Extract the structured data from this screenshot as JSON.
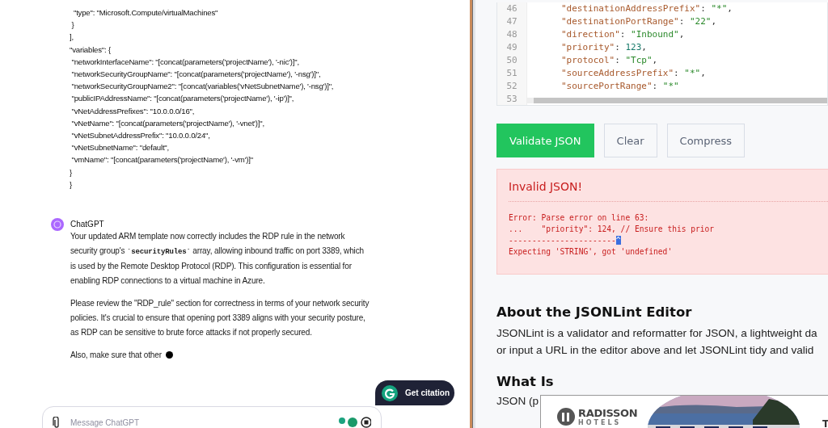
{
  "chat": {
    "code_lines": [
      "  \"type\": \"Microsoft.Compute/virtualMachines\"",
      " }",
      "],",
      "\"variables\": {",
      " \"networkInterfaceName\": \"[concat(parameters('projectName'), '-nic')]\",",
      " \"networkSecurityGroupName\": \"[concat(parameters('projectName'), '-nsg')]\",",
      " \"networkSecurityGroupName2\": \"[concat(variables('vNetSubnetName'), '-nsg')]\",",
      " \"publicIPAddressName\": \"[concat(parameters('projectName'), '-ip')]\",",
      " \"vNetAddressPrefixes\": \"10.0.0.0/16\",",
      " \"vNetName\": \"[concat(parameters('projectName'), '-vnet')]\",",
      " \"vNetSubnetAddressPrefix\": \"10.0.0.0/24\",",
      " \"vNetSubnetName\": \"default\",",
      " \"vmName\": \"[concat(parameters('projectName'), '-vm')]\"",
      "}",
      "}"
    ],
    "author": "ChatGPT",
    "paragraphs": [
      [
        {
          "kind": "plain",
          "text": "Your updated ARM template now correctly includes the RDP rule in the network security group's "
        },
        {
          "kind": "code",
          "text": "`securityRules`"
        },
        {
          "kind": "plain",
          "text": " array, allowing inbound traffic on port 3389, which is used by the Remote Desktop Protocol (RDP). This configuration is essential for enabling RDP connections to a virtual machine in Azure."
        }
      ],
      [
        {
          "kind": "plain",
          "text": "Please review the \"RDP_rule\" section for correctness in terms of your network security policies. It's crucial to ensure that opening port 3389 aligns with your security posture, as RDP can be sensitive to brute force attacks if not properly secured."
        }
      ],
      [
        {
          "kind": "plain",
          "text": "Also, make sure that other"
        }
      ]
    ],
    "streaming": true,
    "citation_button": "Get citation",
    "message_field": {
      "placeholder": "Message ChatGPT"
    }
  },
  "editor": {
    "lines": [
      {
        "number": "46",
        "tokens": [
          {
            "kind": "key",
            "text": "\"destinationAddressPrefix\""
          },
          {
            "kind": "punct",
            "text": ": "
          },
          {
            "kind": "string",
            "text": "\"*\""
          },
          {
            "kind": "punct",
            "text": ","
          }
        ]
      },
      {
        "number": "47",
        "tokens": [
          {
            "kind": "key",
            "text": "\"destinationPortRange\""
          },
          {
            "kind": "punct",
            "text": ": "
          },
          {
            "kind": "string",
            "text": "\"22\""
          },
          {
            "kind": "punct",
            "text": ","
          }
        ]
      },
      {
        "number": "48",
        "tokens": [
          {
            "kind": "key",
            "text": "\"direction\""
          },
          {
            "kind": "punct",
            "text": ": "
          },
          {
            "kind": "string",
            "text": "\"Inbound\""
          },
          {
            "kind": "punct",
            "text": ","
          }
        ]
      },
      {
        "number": "49",
        "tokens": [
          {
            "kind": "key",
            "text": "\"priority\""
          },
          {
            "kind": "punct",
            "text": ": "
          },
          {
            "kind": "number",
            "text": "123"
          },
          {
            "kind": "punct",
            "text": ","
          }
        ]
      },
      {
        "number": "50",
        "tokens": [
          {
            "kind": "key",
            "text": "\"protocol\""
          },
          {
            "kind": "punct",
            "text": ": "
          },
          {
            "kind": "string",
            "text": "\"Tcp\""
          },
          {
            "kind": "punct",
            "text": ","
          }
        ]
      },
      {
        "number": "51",
        "tokens": [
          {
            "kind": "key",
            "text": "\"sourceAddressPrefix\""
          },
          {
            "kind": "punct",
            "text": ": "
          },
          {
            "kind": "string",
            "text": "\"*\""
          },
          {
            "kind": "punct",
            "text": ","
          }
        ]
      },
      {
        "number": "52",
        "tokens": [
          {
            "kind": "key",
            "text": "\"sourcePortRange\""
          },
          {
            "kind": "punct",
            "text": ": "
          },
          {
            "kind": "string",
            "text": "\"*\""
          }
        ]
      },
      {
        "number": "53"
      }
    ]
  },
  "buttons": [
    {
      "label": "Validate JSON",
      "kind": "primary"
    },
    {
      "label": "Clear",
      "kind": "secondary"
    },
    {
      "label": "Compress",
      "kind": "secondary"
    }
  ],
  "error": {
    "title": "Invalid JSON!",
    "lines": [
      "Error: Parse error on line 63:",
      "...    \"priority\": 124, // Ensure this prior"
    ],
    "pointer": {
      "dashes": "-----------------------",
      "caret": "^"
    },
    "message": "Expecting 'STRING', got 'undefined'"
  },
  "about": {
    "heading": "About the JSONLint Editor",
    "lines": [
      "JSONLint is a validator and reformatter for JSON, a lightweight da",
      "or input a URL in the editor above and let JSONLint tidy and valid"
    ]
  },
  "what_is": {
    "heading": "What Is",
    "text": "JSON (p"
  },
  "ad": {
    "brand": "RADISSON",
    "sub": "HOTELS",
    "tail": "T"
  }
}
